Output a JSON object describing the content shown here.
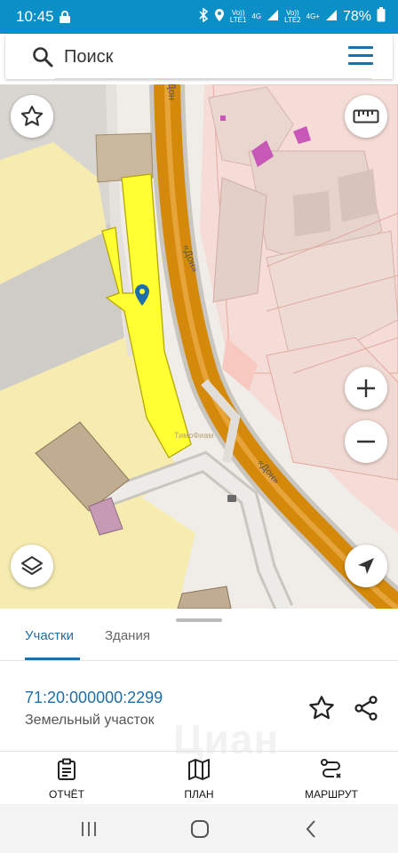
{
  "status_bar": {
    "time": "10:45",
    "net1_top": "Vo))",
    "net1_bottom": "LTE1",
    "net1_gen": "4G",
    "net2_top": "Vo))",
    "net2_bottom": "LTE2",
    "net2_gen": "4G+",
    "battery": "78%"
  },
  "search": {
    "placeholder": "Поиск"
  },
  "map": {
    "road_label_1": "«Дон»",
    "road_label_2": "«Дон»",
    "road_label_3": "Дон",
    "watermark": "ТимоФиам"
  },
  "sheet": {
    "tabs": [
      {
        "label": "Участки",
        "active": true
      },
      {
        "label": "Здания",
        "active": false
      }
    ],
    "parcel": {
      "cadastral_number": "71:20:000000:2299",
      "type": "Земельный участок"
    },
    "watermark": "Циан",
    "actions": [
      {
        "label": "ОТЧЁТ",
        "icon": "report-icon"
      },
      {
        "label": "ПЛАН",
        "icon": "map-plan-icon"
      },
      {
        "label": "МАРШРУТ",
        "icon": "route-icon"
      }
    ]
  },
  "colors": {
    "status_bar": "#0b8fc7",
    "accent": "#1e6ea8",
    "parcel_fill": "#ffff33",
    "road": "#d4890a"
  }
}
